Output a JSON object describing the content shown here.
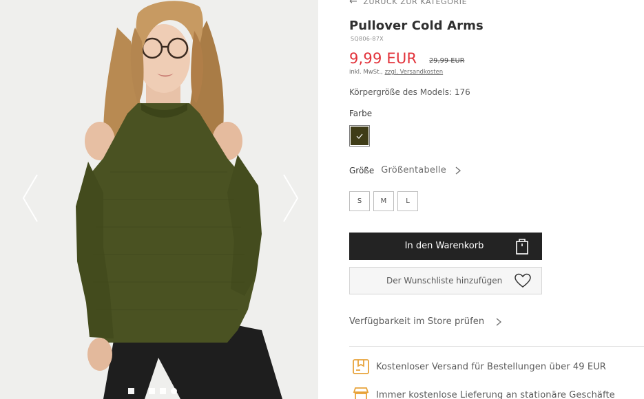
{
  "gallery": {
    "prev_icon": "chevron-left-icon",
    "next_icon": "chevron-right-icon",
    "dots_count": 4,
    "active_dot": 3
  },
  "product": {
    "back_label": "ZURÜCK ZUR KATEGORIE",
    "title": "Pullover Cold Arms",
    "sku": "SQ806-87X",
    "price": "9,99 EUR",
    "old_price": "29,99 EUR",
    "vat_prefix": "inkl. MwSt.,",
    "shipping_link": "zzgl. Versandkosten",
    "model_height": "Körpergröße des Models: 176",
    "color_label": "Farbe",
    "color_swatch": "#3f3c17",
    "size_label": "Größe",
    "size_chart_link": "Größentabelle",
    "sizes": [
      "S",
      "M",
      "L"
    ],
    "add_to_cart": "In den Warenkorb",
    "add_to_wishlist": "Der Wunschliste hinzufügen",
    "store_availability": "Verfügbarkeit im Store prüfen"
  },
  "benefits": [
    {
      "icon": "package-icon",
      "text": "Kostenloser Versand für Bestellungen über 49 EUR"
    },
    {
      "icon": "store-icon",
      "text": "Immer kostenlose Lieferung an stationäre Geschäfte"
    }
  ],
  "colors": {
    "price_red": "#e2323a",
    "button_dark": "#232323",
    "benefit_icon": "#e8a33a",
    "sweater": "#4a5222"
  }
}
